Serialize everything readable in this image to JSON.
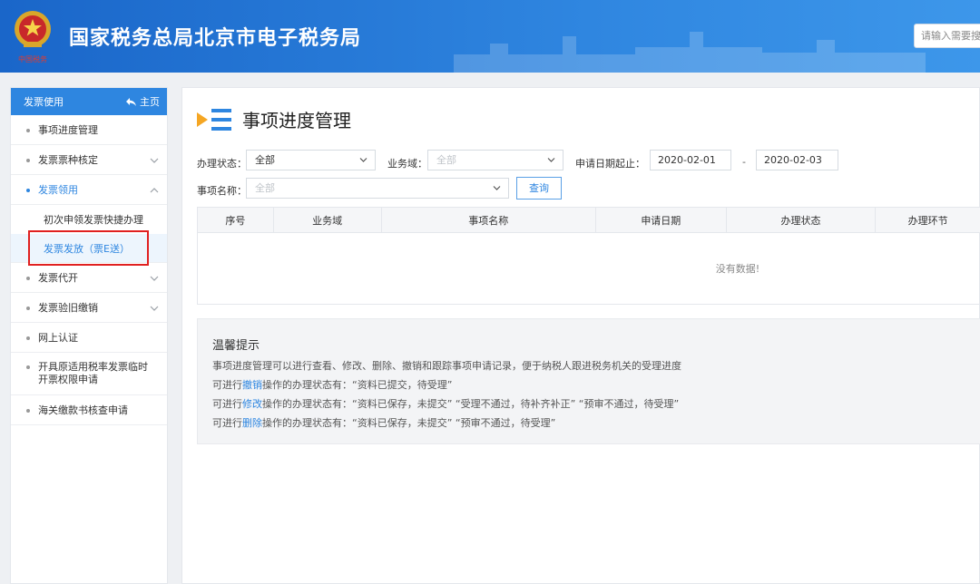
{
  "header": {
    "title": "国家税务总局北京市电子税务局",
    "emblem_caption": "中国税务",
    "search_placeholder": "请输入需要搜索"
  },
  "sidebar": {
    "head_label": "发票使用",
    "home_label": "主页",
    "items": [
      {
        "label": "事项进度管理",
        "has_chevron": false
      },
      {
        "label": "发票票种核定",
        "has_chevron": true,
        "chevron": "down"
      },
      {
        "label": "发票领用",
        "has_chevron": true,
        "chevron": "up",
        "expanded": true
      },
      {
        "label": "发票代开",
        "has_chevron": true,
        "chevron": "down"
      },
      {
        "label": "发票验旧缴销",
        "has_chevron": true,
        "chevron": "down"
      },
      {
        "label": "网上认证",
        "has_chevron": false
      },
      {
        "label": "开具原适用税率发票临时开票权限申请",
        "has_chevron": false
      },
      {
        "label": "海关缴款书核查申请",
        "has_chevron": false
      }
    ],
    "sub_items": [
      {
        "label": "初次申领发票快捷办理"
      },
      {
        "label": "发票发放（票E送）",
        "current": true
      }
    ]
  },
  "main": {
    "page_title": "事项进度管理",
    "filters": {
      "status_label": "办理状态：",
      "status_value": "全部",
      "domain_label": "业务域：",
      "domain_value": "全部",
      "date_label": "申请日期起止：",
      "date_from": "2020-02-01",
      "date_sep": "-",
      "date_to": "2020-02-03",
      "item_label": "事项名称：",
      "item_value": "全部",
      "query_button": "查询"
    },
    "table": {
      "columns": [
        "序号",
        "业务域",
        "事项名称",
        "申请日期",
        "办理状态",
        "办理环节"
      ],
      "empty_text": "没有数据!"
    },
    "tips": {
      "title": "温馨提示",
      "line1": "事项进度管理可以进行查看、修改、删除、撤销和跟踪事项申请记录，便于纳税人跟进税务机关的受理进度",
      "line2_pre": "可进行",
      "line2_link": "撤销",
      "line2_post": "操作的办理状态有：“资料已提交，待受理”",
      "line3_pre": "可进行",
      "line3_link": "修改",
      "line3_post": "操作的办理状态有：“资料已保存，未提交”  “受理不通过，待补齐补正”  “预审不通过，待受理”",
      "line4_pre": "可进行",
      "line4_link": "删除",
      "line4_post": "操作的办理状态有：“资料已保存，未提交”  “预审不通过，待受理”"
    }
  },
  "colors": {
    "header_start": "#1a66c9",
    "header_end": "#3d97ea",
    "accent": "#2e86e0",
    "highlight_box": "#e02020"
  }
}
